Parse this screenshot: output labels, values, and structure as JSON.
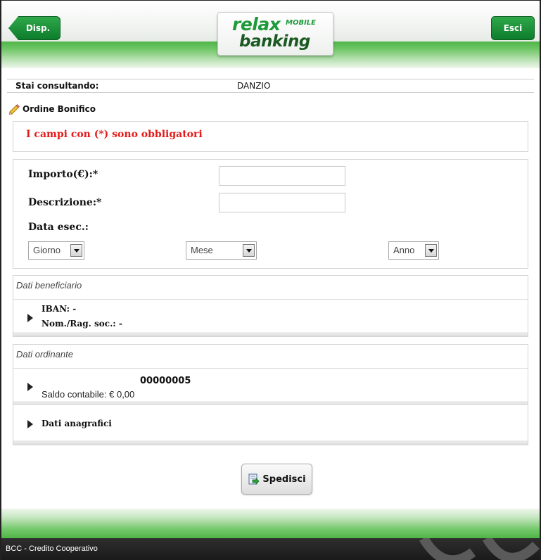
{
  "header": {
    "back_label": "Disp.",
    "exit_label": "Esci",
    "logo_relax": "relax",
    "logo_mobile": "MOBILE",
    "logo_banking": "banking"
  },
  "context": {
    "label": "Stai consultando:",
    "value": "DANZIO"
  },
  "page_title": "Ordine Bonifico",
  "required_notice": "I campi con (*) sono obbligatori",
  "form": {
    "amount_label": "Importo(€):*",
    "amount_value": "",
    "description_label": "Descrizione:*",
    "description_value": "",
    "date_label": "Data esec.:",
    "day_select": "Giorno",
    "month_select": "Mese",
    "year_select": "Anno"
  },
  "beneficiary": {
    "header": "Dati beneficiario",
    "iban_label": "IBAN: -",
    "name_label": "Nom./Rag. soc.: -"
  },
  "orderer": {
    "header": "Dati ordinante",
    "account": "00000005",
    "balance": "Saldo contabile: € 0,00",
    "personal_data": "Dati anagrafici"
  },
  "send_label": "Spedisci",
  "footer_text": "BCC - Credito Cooperativo",
  "colors": {
    "brand_green": "#0d7d2c",
    "required_red": "#e51a1a"
  }
}
